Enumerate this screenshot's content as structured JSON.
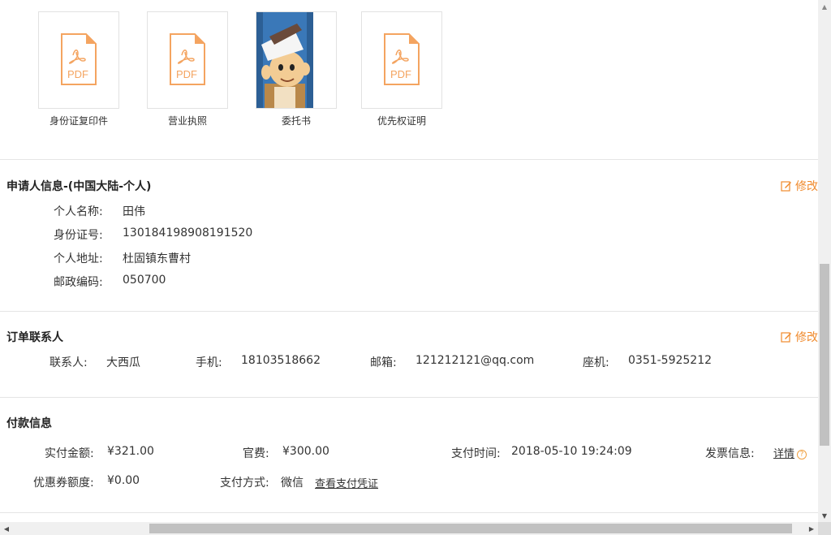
{
  "attachments": [
    {
      "name": "身份证复印件",
      "type_label": "PDF",
      "kind": "pdf"
    },
    {
      "name": "营业执照",
      "type_label": "PDF",
      "kind": "pdf"
    },
    {
      "name": "委托书",
      "kind": "image"
    },
    {
      "name": "优先权证明",
      "type_label": "PDF",
      "kind": "pdf"
    }
  ],
  "applicant": {
    "title": "申请人信息-(中国大陆-个人)",
    "edit_label": "修改",
    "fields": [
      {
        "label": "个人名称:",
        "value": "田伟"
      },
      {
        "label": "身份证号:",
        "value": "130184198908191520"
      },
      {
        "label": "个人地址:",
        "value": "杜固镇东曹村"
      },
      {
        "label": "邮政编码:",
        "value": "050700"
      }
    ]
  },
  "contact": {
    "title": "订单联系人",
    "edit_label": "修改",
    "fields": [
      {
        "label": "联系人:",
        "value": "大西瓜"
      },
      {
        "label": "手机:",
        "value": "18103518662"
      },
      {
        "label": "邮箱:",
        "value": "121212121@qq.com"
      },
      {
        "label": "座机:",
        "value": "0351-5925212"
      }
    ]
  },
  "payment": {
    "title": "付款信息",
    "paid_label": "实付金额:",
    "paid_value": "¥321.00",
    "fee_label": "官费:",
    "fee_value": "¥300.00",
    "time_label": "支付时间:",
    "time_value": "2018-05-10 19:24:09",
    "invoice_label": "发票信息:",
    "invoice_link": "详情",
    "coupon_label": "优惠券额度:",
    "coupon_value": "¥0.00",
    "method_label": "支付方式:",
    "method_value": "微信",
    "voucher_link": "查看支付凭证"
  },
  "colors": {
    "accent": "#f08a2c",
    "pdf": "#f4a460",
    "divider": "#e5e5e5"
  },
  "icons": {
    "edit": "edit-icon",
    "help": "help-icon",
    "pdf": "pdf-file-icon"
  }
}
